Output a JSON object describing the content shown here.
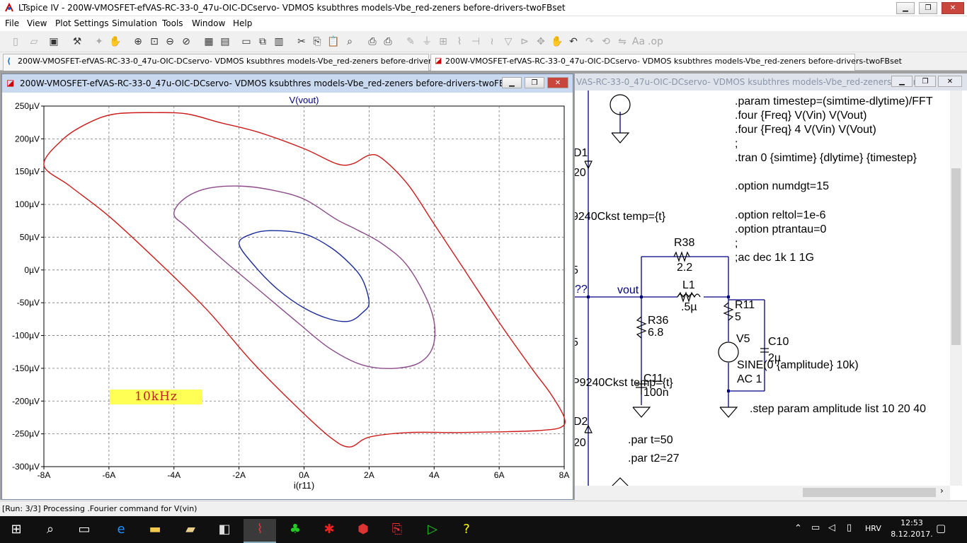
{
  "window": {
    "title": "LTspice IV - 200W-VMOSFET-efVAS-RC-33-0_47u-OIC-DCservo- VDMOS ksubthres models-Vbe_red-zeners before-drivers-twoFBset"
  },
  "menu": [
    "File",
    "View",
    "Plot Settings",
    "Simulation",
    "Tools",
    "Window",
    "Help"
  ],
  "tabs": [
    {
      "label": "200W-VMOSFET-efVAS-RC-33-0_47u-OIC-DCservo- VDMOS ksubthres models-Vbe_red-zeners before-drivers-twoFBset"
    },
    {
      "label": "200W-VMOSFET-efVAS-RC-33-0_47u-OIC-DCservo- VDMOS ksubthres models-Vbe_red-zeners before-drivers-twoFBset"
    }
  ],
  "plot_window": {
    "title": "200W-VMOSFET-efVAS-RC-33-0_47u-OIC-DCservo- VDMOS ksubthres models-Vbe_red-zeners before-drivers-twoFBset",
    "annotation": "10kHz"
  },
  "schematic_window": {
    "title": "VAS-RC-33-0_47u-OIC-DCservo- VDMOS ksubthres models-Vbe_red-zeners before..."
  },
  "schematic_text": {
    "l1": ".param timestep=(simtime-dlytime)/FFT",
    "l2": ".four {Freq} V(Vin) V(Vout)",
    "l3": ".four {Freq} 4 V(Vin) V(Vout)",
    "l4": ";",
    "l5": ".tran 0 {simtime} {dlytime} {timestep}",
    "l6": ".option numdgt=15",
    "l7": ".option reltol=1e-6",
    "l8": ".option ptrantau=0",
    "l9": ";",
    "l10": ";ac dec 1k 1 1G",
    "d1": "D1",
    "d1v": "20",
    "q1": "9240Ckst temp={t}",
    "r38": "R38",
    "r38v": "2.2",
    "qq": "??",
    "vout": "vout",
    "l1n": "L1",
    "l1v": ".5µ",
    "r11": "R11",
    "r11v": "5",
    "r36": "R36",
    "r36v": "6.8",
    "v5": "V5",
    "c10": "C10",
    "c10v": "2µ",
    "sine": "SINE(0 {amplitude} 10k)",
    "ac": "AC 1",
    "q2": "P9240Ckst temp={t}",
    "c11": "C11",
    "c11v": "100n",
    "step": ".step param amplitude list 10 20 40",
    "d2": "D2",
    "d2v": "20",
    "part": ".par t=50",
    "part2": ".par t2=27",
    "five1": "5",
    "five2": "5"
  },
  "status": "[Run: 3/3] Processing .Fourier command for V(vin)",
  "tray": {
    "lang": "HRV",
    "time": "12:53",
    "date": "8.12.2017."
  },
  "chart_data": {
    "type": "line",
    "title": "V(vout)",
    "xlabel": "i(r11)",
    "ylabel": "",
    "xlim": [
      -8,
      8
    ],
    "ylim": [
      -300,
      250
    ],
    "x_ticks": [
      "-8A",
      "-6A",
      "-4A",
      "-2A",
      "0A",
      "2A",
      "4A",
      "6A",
      "8A"
    ],
    "y_ticks": [
      "250µV",
      "200µV",
      "150µV",
      "100µV",
      "50µV",
      "0µV",
      "-50µV",
      "-100µV",
      "-150µV",
      "-200µV",
      "-250µV",
      "-300µV"
    ],
    "grid": true,
    "series": [
      {
        "color": "#cc1b1b",
        "x": [
          -8,
          -7.4,
          -6.6,
          -5.8,
          -4.6,
          -3.6,
          -2.6,
          -1.4,
          0,
          1,
          1.5,
          2,
          2.4,
          3.2,
          4,
          5,
          6,
          7,
          7.6,
          8,
          7.9,
          7.2,
          6,
          4.7,
          3.2,
          2,
          1.4,
          0.8,
          -0.2,
          -1.6,
          -3,
          -4.6,
          -6,
          -7.2,
          -8
        ],
        "y": [
          160,
          200,
          225,
          238,
          240,
          238,
          225,
          210,
          185,
          162,
          162,
          175,
          170,
          130,
          70,
          -5,
          -80,
          -150,
          -190,
          -225,
          -240,
          -245,
          -247,
          -248,
          -248,
          -255,
          -270,
          -255,
          -210,
          -140,
          -60,
          18,
          82,
          128,
          160
        ]
      },
      {
        "color": "#8b4a8a",
        "x": [
          -4,
          -3.7,
          -3,
          -2,
          -1,
          0,
          1,
          1.6,
          2.4,
          3.2,
          3.9,
          4,
          3.6,
          2.8,
          1.8,
          0.8,
          -0.2,
          -1.4,
          -2.6,
          -3.6,
          -4
        ],
        "y": [
          85,
          108,
          124,
          128,
          122,
          108,
          77,
          62,
          40,
          5,
          -60,
          -110,
          -140,
          -150,
          -145,
          -120,
          -80,
          -30,
          20,
          65,
          85
        ]
      },
      {
        "color": "#1a2a9a",
        "x": [
          -2,
          -1.6,
          -1,
          0,
          0.8,
          1.4,
          1.8,
          2,
          1.8,
          1.4,
          0.8,
          0,
          -0.8,
          -1.5,
          -2
        ],
        "y": [
          40,
          55,
          60,
          55,
          35,
          10,
          -15,
          -50,
          -65,
          -78,
          -75,
          -58,
          -30,
          5,
          40
        ]
      }
    ]
  }
}
